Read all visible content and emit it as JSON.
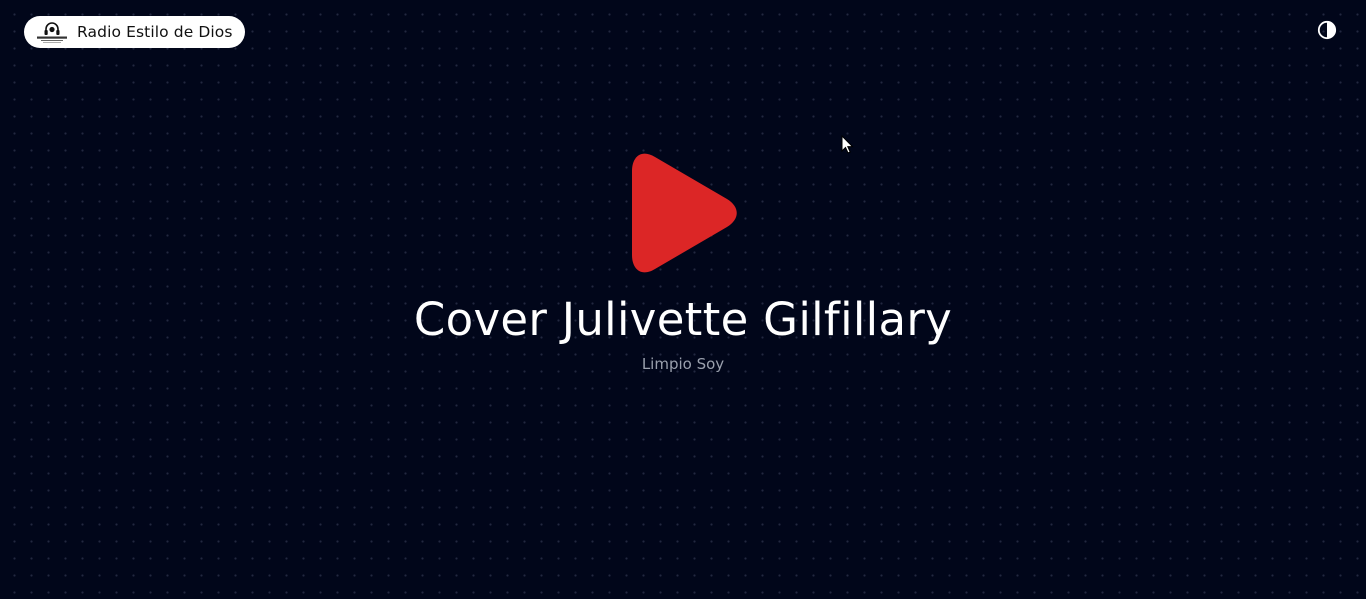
{
  "header": {
    "brand_name": "Radio Estilo de Dios",
    "logo_icon": "headphones-logo-icon",
    "theme_toggle_icon": "contrast-icon"
  },
  "player": {
    "play_icon": "play-icon",
    "title": "Cover Julivette Gilfillary",
    "subtitle": "Limpio Soy"
  },
  "colors": {
    "background": "#01061a",
    "accent_play": "#dc2626",
    "title": "#ffffff",
    "subtitle": "#9aa0ad",
    "pill": "#ffffff"
  }
}
